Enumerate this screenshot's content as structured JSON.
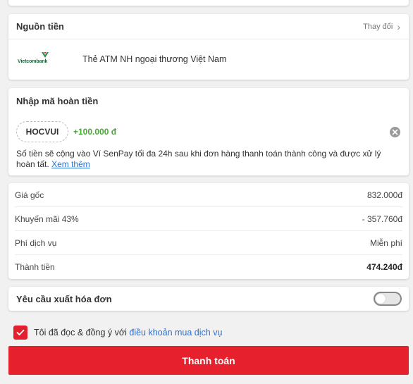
{
  "payment_source": {
    "title": "Nguồn tiền",
    "change_label": "Thay đổi",
    "bank_logo_text": "Vietcombank",
    "bank_name": "Thẻ ATM NH ngoại thương Việt Nam"
  },
  "voucher": {
    "title": "Nhập mã hoàn tiền",
    "code": "HOCVUI",
    "amount": "+100.000 đ",
    "note": "Số tiền sẽ cộng vào Ví SenPay tối đa 24h sau khi đơn hàng thanh toán thành công và được xử lý hoàn tất.",
    "more_link": "Xem thêm"
  },
  "summary": {
    "rows": [
      {
        "label": "Giá gốc",
        "value": "832.000đ"
      },
      {
        "label": "Khuyến mãi 43%",
        "value": "- 357.760đ"
      },
      {
        "label": "Phí dịch vụ",
        "value": "Miễn phí"
      },
      {
        "label": "Thành tiền",
        "value": "474.240đ"
      }
    ]
  },
  "invoice": {
    "title": "Yêu cầu xuất hóa đơn",
    "toggle_on": false
  },
  "agreement": {
    "checked": true,
    "text": "Tôi đã đọc & đồng ý với",
    "link": "điều khoản mua dịch vụ"
  },
  "pay_button": {
    "label": "Thanh toán"
  },
  "colors": {
    "accent": "#e7202d",
    "link": "#2b6fd6",
    "positive": "#49a936",
    "bank_green": "#1f5f3c"
  }
}
